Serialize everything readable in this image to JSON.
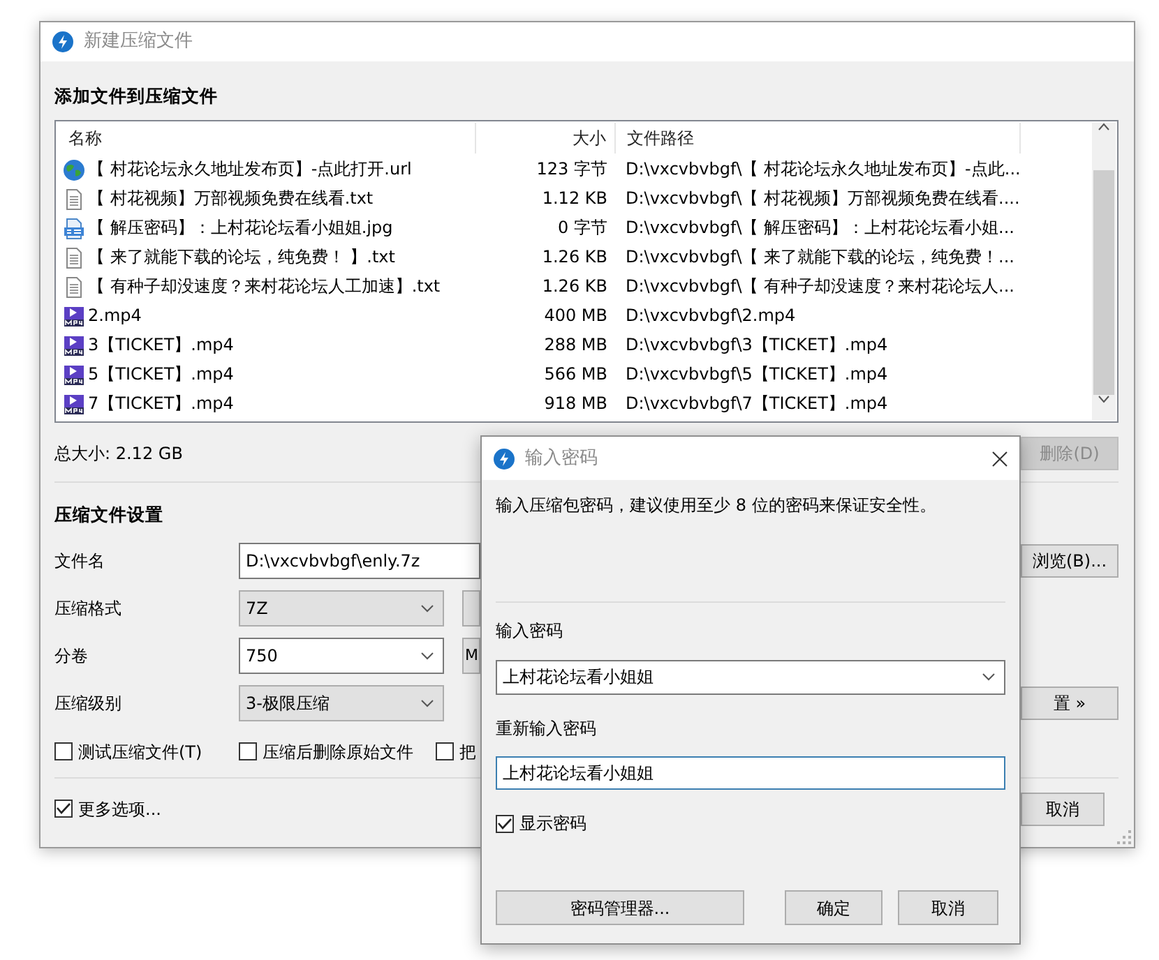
{
  "main_window": {
    "title": "新建压缩文件",
    "files_heading": "添加文件到压缩文件",
    "file_list": {
      "columns": [
        "名称",
        "大小",
        "文件路径"
      ],
      "rows": [
        {
          "kind": "url",
          "name": "【 村花论坛永久地址发布页】-点此打开.url",
          "size": "123 字节",
          "path": "D:\\vxcvbvbgf\\【 村花论坛永久地址发布页】-点此..."
        },
        {
          "kind": "txt",
          "name": "【 村花视频】万部视频免费在线看.txt",
          "size": "1.12 KB",
          "path": "D:\\vxcvbvbgf\\【 村花视频】万部视频免费在线看...."
        },
        {
          "kind": "jpg",
          "name": "【 解压密码】：上村花论坛看小姐姐.jpg",
          "size": "0 字节",
          "path": "D:\\vxcvbvbgf\\【 解压密码】：上村花论坛看小姐..."
        },
        {
          "kind": "txt",
          "name": "【 来了就能下载的论坛，纯免费！ 】.txt",
          "size": "1.26 KB",
          "path": "D:\\vxcvbvbgf\\【 来了就能下载的论坛，纯免费！..."
        },
        {
          "kind": "txt",
          "name": "【 有种子却没速度？来村花论坛人工加速】.txt",
          "size": "1.26 KB",
          "path": "D:\\vxcvbvbgf\\【 有种子却没速度？来村花论坛人..."
        },
        {
          "kind": "mp4",
          "name": "2.mp4",
          "size": "400 MB",
          "path": "D:\\vxcvbvbgf\\2.mp4"
        },
        {
          "kind": "mp4",
          "name": "3【TICKET】.mp4",
          "size": "288 MB",
          "path": "D:\\vxcvbvbgf\\3【TICKET】.mp4"
        },
        {
          "kind": "mp4",
          "name": "5【TICKET】.mp4",
          "size": "566 MB",
          "path": "D:\\vxcvbvbgf\\5【TICKET】.mp4"
        },
        {
          "kind": "mp4",
          "name": "7【TICKET】.mp4",
          "size": "918 MB",
          "path": "D:\\vxcvbvbgf\\7【TICKET】.mp4"
        }
      ]
    },
    "total_size": "总大小: 2.12 GB",
    "delete_button": "删除(D)",
    "settings_heading": "压缩文件设置",
    "settings": [
      {
        "kind": "field",
        "label": "文件名",
        "value": "D:\\vxcvbvbgf\\enly.7z",
        "right_button": "浏览(B)..."
      },
      {
        "kind": "select",
        "label": "压缩格式",
        "value": "7Z",
        "editable": false,
        "side_control": {
          "kind": "button"
        }
      },
      {
        "kind": "select",
        "label": "分卷",
        "value": "750",
        "editable": true,
        "side_control": {
          "kind": "select",
          "text": "M"
        }
      },
      {
        "kind": "select",
        "label": "压缩级别",
        "value": "3-极限压缩",
        "editable": false,
        "right_button": "置 »"
      }
    ],
    "checkboxes": [
      {
        "label": "测试压缩文件(T)",
        "checked": false
      },
      {
        "label": "压缩后删除原始文件",
        "checked": false
      },
      {
        "label": "把",
        "checked": false
      }
    ],
    "more_options": {
      "label": "更多选项...",
      "checked": true
    },
    "cancel_button": "取消"
  },
  "password_dialog": {
    "title": "输入密码",
    "description": "输入压缩包密码，建议使用至少 8 位的密码来保证安全性。",
    "password_label": "输入密码",
    "password": "上村花论坛看小姐姐",
    "confirm_label": "重新输入密码",
    "confirm": "上村花论坛看小姐姐",
    "show_password": {
      "label": "显示密码",
      "checked": true
    },
    "buttons": [
      "密码管理器...",
      "确定",
      "取消"
    ]
  }
}
